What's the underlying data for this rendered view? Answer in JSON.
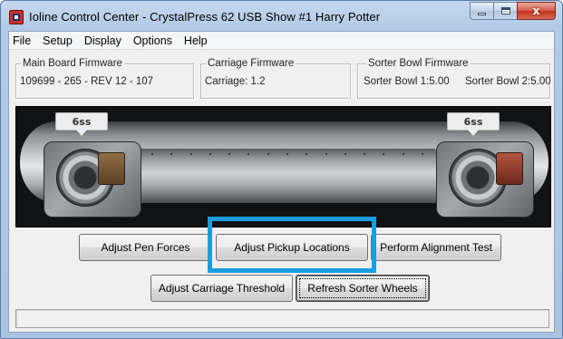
{
  "window": {
    "title": "Ioline Control Center -  CrystalPress   62   USB    Show #1 Harry Potter",
    "close_glyph": "x"
  },
  "menu": [
    "File",
    "Setup",
    "Display",
    "Options",
    "Help"
  ],
  "firmware": {
    "main_board": {
      "label": "Main Board Firmware",
      "value": "109699 - 265 - REV 12 - 107"
    },
    "carriage": {
      "label": "Carriage Firmware",
      "value": "Carriage: 1.2"
    },
    "sorter_bowl": {
      "label": "Sorter Bowl Firmware",
      "value_1": "Sorter Bowl 1:5.00",
      "value_2": "Sorter Bowl 2:5.00"
    }
  },
  "machine": {
    "left_bowl_label": "6ss",
    "right_bowl_label": "6ss"
  },
  "buttons": {
    "adjust_pen_forces": "Adjust Pen Forces",
    "adjust_pickup_locations": "Adjust Pickup Locations",
    "perform_alignment_test": "Perform Alignment Test",
    "adjust_carriage_threshold": "Adjust Carriage Threshold",
    "refresh_sorter_wheels": "Refresh Sorter Wheels"
  },
  "status_bar": {
    "text": ""
  },
  "colors": {
    "highlight": "#1a9ee0",
    "dialog_background": "#f0f0f0"
  },
  "highlighted_element": "adjust-pickup-locations-button"
}
